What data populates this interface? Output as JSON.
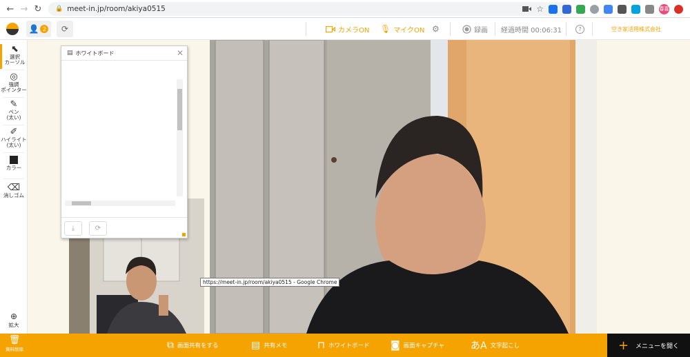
{
  "browser": {
    "url": "meet-in.jp/room/akiya0515",
    "back_icon": "←",
    "forward_icon": "→",
    "reload_icon": "↻",
    "profile_label": "春喜"
  },
  "header": {
    "user_count": "2",
    "camera_label": "カメラON",
    "mic_label": "マイクON",
    "record_label": "録画",
    "elapsed_label": "経過時間 00:06:31",
    "help_label": "?",
    "company_label": "空き家活用株式会社"
  },
  "left_toolbar": {
    "select_cursor": "選択\nカーソル",
    "pointer": "強調\nポインター",
    "pen": "ペン\n(太い)",
    "highlight": "ハイライト\n(太い)",
    "color": "カラー",
    "eraser": "消しゴム",
    "zoom": "拡大"
  },
  "whiteboard": {
    "title": "ホワイトボード"
  },
  "tooltip": "https://meet-in.jp/room/akiya0515 - Google Chrome",
  "bottom_bar": {
    "delete_label": "資料削除",
    "share_screen": "画面共有をする",
    "shared_memo": "共有メモ",
    "whiteboard": "ホワイトボード",
    "screen_capture": "画面キャプチャ",
    "transcription": "文字起こし",
    "open_menu": "メニューを開く"
  },
  "colors": {
    "accent": "#f5a300",
    "dark": "#111111"
  }
}
